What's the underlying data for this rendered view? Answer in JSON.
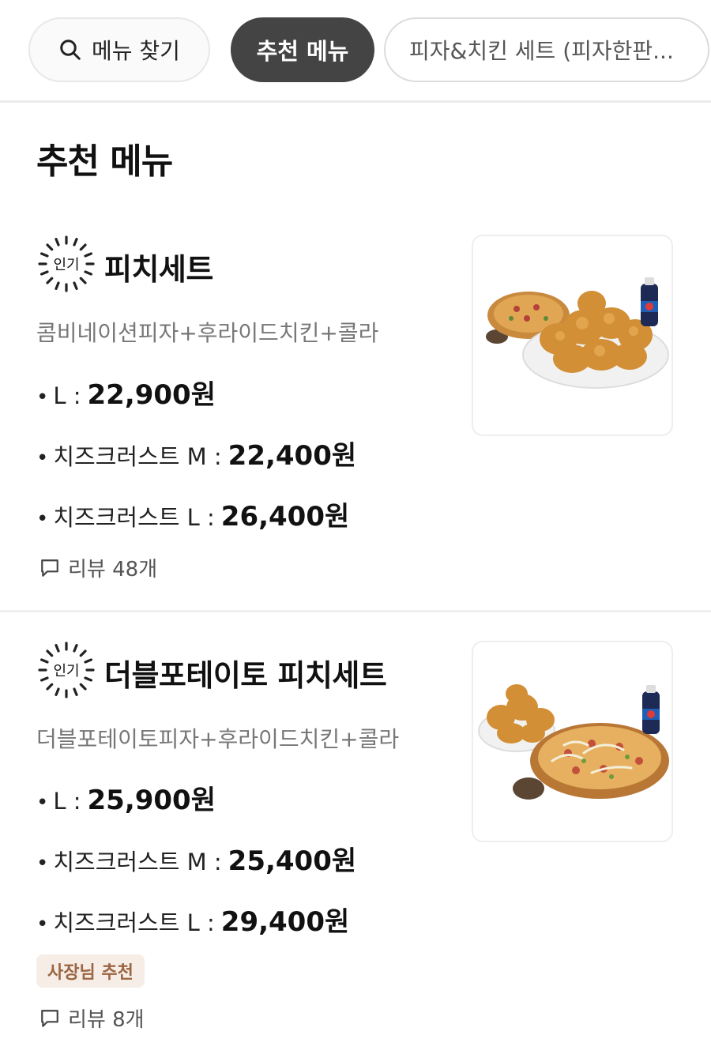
{
  "chips": {
    "search_label": "메뉴 찾기",
    "active_label": "추천 메뉴",
    "next_label": "피자&치킨 세트 (피자한판..."
  },
  "section": {
    "title": "추천 메뉴"
  },
  "badge_label": "인기",
  "menu": [
    {
      "name": "피치세트",
      "description": "콤비네이션피자+후라이드치킨+콜라",
      "prices": [
        {
          "label": "L :",
          "amount": "22,900원"
        },
        {
          "label": "치즈크러스트 M :",
          "amount": "22,400원"
        },
        {
          "label": "치즈크러스트 L :",
          "amount": "26,400원"
        }
      ],
      "review": "리뷰 48개"
    },
    {
      "name": "더블포테이토 피치세트",
      "description": "더블포테이토피자+후라이드치킨+콜라",
      "prices": [
        {
          "label": "L :",
          "amount": "25,900원"
        },
        {
          "label": "치즈크러스트 M :",
          "amount": "25,400원"
        },
        {
          "label": "치즈크러스트 L :",
          "amount": "29,400원"
        }
      ],
      "tag": "사장님 추천",
      "review": "리뷰 8개"
    }
  ],
  "colors": {
    "active_chip": "#444444",
    "owner_tag_bg": "#f6ede6",
    "owner_tag_text": "#9a6542"
  }
}
